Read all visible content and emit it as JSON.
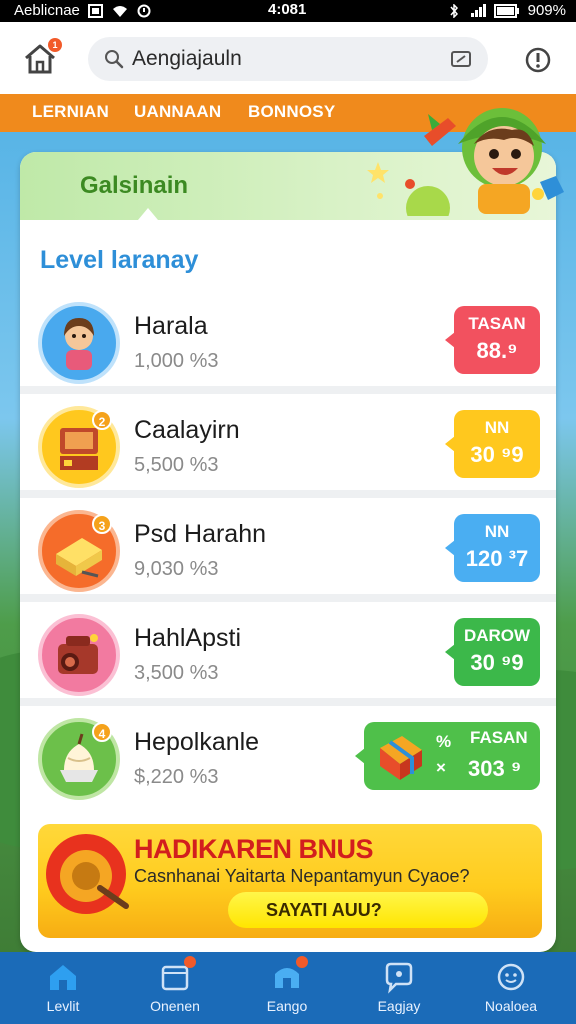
{
  "status_bar": {
    "left_text": "Aeblicnae",
    "time": "4:081",
    "battery": "909%"
  },
  "app_bar": {
    "home_badge": "1",
    "search_value": "Aengiajauln"
  },
  "tabs": [
    {
      "label": "LERNIAN"
    },
    {
      "label": "UANNAAN"
    },
    {
      "label": "BONNOSY"
    }
  ],
  "card": {
    "header_title": "Galsinain",
    "section_title": "Level laranay"
  },
  "levels": [
    {
      "name": "Harala",
      "points": "1,000 %3",
      "badge": "",
      "tag_label": "TASAN",
      "tag_value": "88.⁹",
      "tag_color": "#f2515f"
    },
    {
      "name": "Caalayirn",
      "points": "5,500 %3",
      "badge": "2",
      "tag_label": "NN",
      "tag_value": "30 ⁹9",
      "tag_color": "#ffc81e"
    },
    {
      "name": "Psd Harahn",
      "points": "9,030 %3",
      "badge": "3",
      "tag_label": "NN",
      "tag_value": "120 ³7",
      "tag_color": "#4aaef2"
    },
    {
      "name": "HahlApsti",
      "points": "3,500 %3",
      "badge": "",
      "tag_label": "DAROW",
      "tag_value": "30 ⁹9",
      "tag_color": "#3cb84a"
    },
    {
      "name": "Hepolkanle",
      "points": "$,220 %3",
      "badge": "4",
      "tag_label": "FASAN",
      "tag_value": "303 ⁹",
      "tag_color": "#4fc04a",
      "tag_x1": "%",
      "tag_x2": "×"
    }
  ],
  "bonus": {
    "title": "HADIKAREN BNUS",
    "subtitle": "Casnhanai Yaitarta Nepantamyun Cyaoe?",
    "button": "SAYATI AUU?"
  },
  "nav": [
    {
      "label": "Levlit",
      "icon": "home-icon",
      "badge": false
    },
    {
      "label": "Onenen",
      "icon": "calendar-icon",
      "badge": true
    },
    {
      "label": "Eango",
      "icon": "shop-icon",
      "badge": true
    },
    {
      "label": "Eagjay",
      "icon": "chat-icon",
      "badge": false
    },
    {
      "label": "Noaloea",
      "icon": "profile-icon",
      "badge": false
    }
  ],
  "colors": {
    "app_blue": "#1b6bb8",
    "tab_orange": "#f08a1c",
    "section_blue": "#2e8fd8",
    "header_green": "#3c8a22"
  }
}
